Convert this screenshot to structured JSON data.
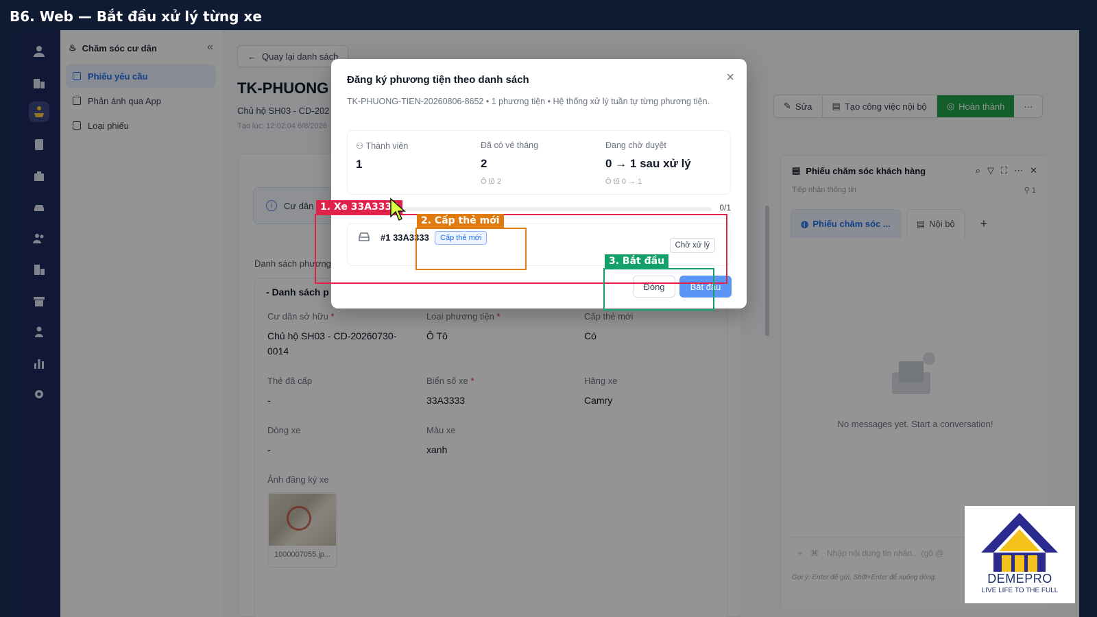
{
  "banner": {
    "title": "B6. Web — Bắt đầu xử lý từng xe"
  },
  "rail": {
    "icons": [
      "user-icon",
      "building-icon",
      "care-icon",
      "calculator-icon",
      "briefcase-icon",
      "car-icon",
      "users-icon",
      "apartment-icon",
      "store-icon",
      "person-icon",
      "chart-icon",
      "gear-icon"
    ],
    "active_index": 2
  },
  "sidenav": {
    "title": "Chăm sóc cư dân",
    "collapse": "«",
    "items": [
      {
        "label": "Phiếu yêu cầu",
        "active": true
      },
      {
        "label": "Phản ánh qua App",
        "active": false
      },
      {
        "label": "Loại phiếu",
        "active": false
      }
    ]
  },
  "page": {
    "back_label": "Quay lại danh sách",
    "title": "TK-PHUONG",
    "owner_line": "Chủ hộ SH03 - CD-202",
    "created": "Tạo lúc: 12:02:04 6/8/2026",
    "info_text": "Cư dân",
    "section_label": "Danh sách phương",
    "subcard_title": "Danh sách p"
  },
  "actions": {
    "edit": "Sửa",
    "task": "Tạo công việc nội bộ",
    "done": "Hoàn thành",
    "more": "···"
  },
  "fields": {
    "owner_label": "Cư dân sở hữu",
    "owner_value": "Chủ hộ SH03 - CD-20260730-0014",
    "type_label": "Loại phương tiện",
    "type_value": "Ô Tô",
    "newcard_label": "Cấp thẻ mới",
    "newcard_value": "Có",
    "issued_label": "Thẻ đã cấp",
    "issued_value": "-",
    "plate_label": "Biển số xe",
    "plate_value": "33A3333",
    "brand_label": "Hãng xe",
    "brand_value": "Camry",
    "model_label": "Dòng xe",
    "model_value": "-",
    "color_label": "Màu xe",
    "color_value": "xanh",
    "photo_label": "Ảnh đăng ký xe",
    "photo_file": "1000007055.jp..."
  },
  "chat": {
    "title": "Phiếu chăm sóc khách hàng",
    "subtitle": "Tiếp nhận thông tin",
    "member_count": "1",
    "tab_main": "Phiếu chăm sóc ...",
    "tab_internal": "Nội bộ",
    "tab_add": "+",
    "empty": "No messages yet. Start a conversation!",
    "composer_placeholder": "Nhập nội dung tin nhắn... (gõ @",
    "hint": "Gợi ý: Enter để gửi, Shift+Enter để xuống dòng."
  },
  "modal": {
    "title": "Đăng ký phương tiện theo danh sách",
    "close": "×",
    "desc": "TK-PHUONG-TIEN-20260806-8652 • 1 phương tiện • Hệ thống xử lý tuần tự từng phương tiện.",
    "stats": [
      {
        "label": "Thành viên",
        "value": "1",
        "sub": ""
      },
      {
        "label": "Đã có vé tháng",
        "value": "2",
        "sub": "Ô tô 2"
      },
      {
        "label": "Đang chờ duyệt",
        "value": "0 → 1 sau xử lý",
        "sub": "Ô tô 0 → 1"
      }
    ],
    "progress_text": "0/1",
    "progress_fraction": 0,
    "vehicle": {
      "name": "#1 33A3333",
      "tag": "Cấp thẻ mới",
      "status": "Chờ xử lý"
    },
    "btn_close": "Đóng",
    "btn_start": "Bắt đầu"
  },
  "annotations": [
    {
      "label": "1. Xe 33A3333",
      "color": "#e0224b"
    },
    {
      "label": "2. Cấp thẻ mới",
      "color": "#e07b10"
    },
    {
      "label": "3. Bắt đầu",
      "color": "#14a06a"
    }
  ],
  "logo": {
    "brand": "DEMEPRO",
    "tagline": "LIVE LIFE TO THE FULL"
  },
  "colors": {
    "accent": "#1f6feb",
    "success": "#22a447",
    "rail": "#1e2a5e"
  }
}
